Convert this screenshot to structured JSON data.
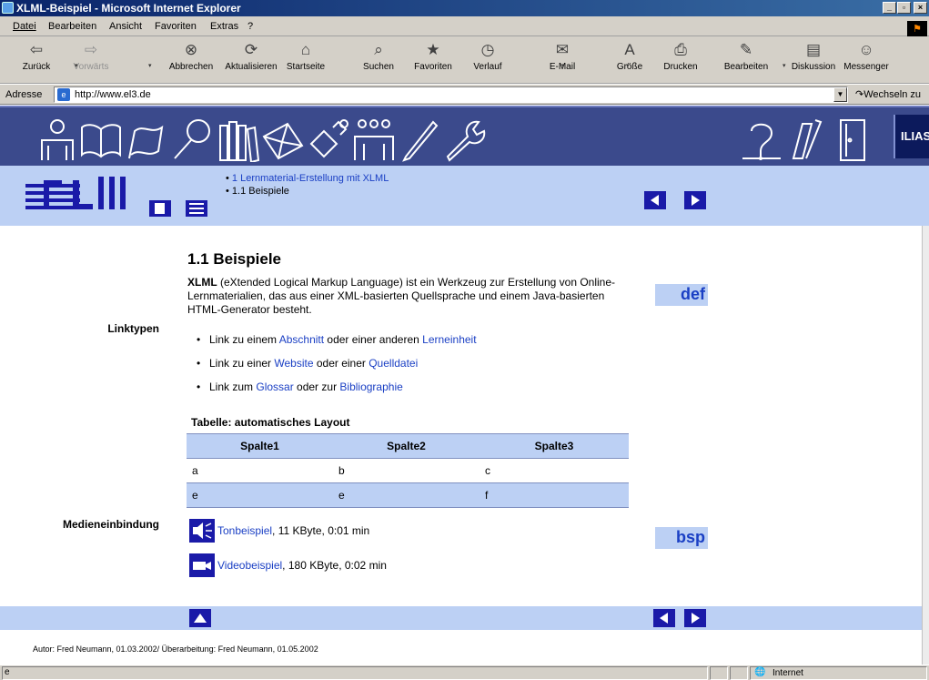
{
  "window": {
    "title": "XLML-Beispiel - Microsoft Internet Explorer",
    "min": "_",
    "max": "\b",
    "close": "x"
  },
  "menu": [
    "Datei",
    "Bearbeiten",
    "Ansicht",
    "Favoriten",
    "Extras",
    "?"
  ],
  "toolbar": [
    {
      "label": "Zurück",
      "icon": "back-icon",
      "glyph": "⇦"
    },
    {
      "label": "Vorwärts",
      "icon": "forward-icon",
      "glyph": "⇨"
    },
    {
      "label": "Abbrechen",
      "icon": "stop-icon",
      "glyph": "⊗"
    },
    {
      "label": "Aktualisieren",
      "icon": "refresh-icon",
      "glyph": "⟳"
    },
    {
      "label": "Startseite",
      "icon": "home-icon",
      "glyph": "⌂"
    },
    {
      "label": "Suchen",
      "icon": "search-icon",
      "glyph": "⌕"
    },
    {
      "label": "Favoriten",
      "icon": "favorites-icon",
      "glyph": "★"
    },
    {
      "label": "Verlauf",
      "icon": "history-icon",
      "glyph": "◷"
    },
    {
      "label": "E-Mail",
      "icon": "mail-icon",
      "glyph": "✉"
    },
    {
      "label": "Größe",
      "icon": "font-size-icon",
      "glyph": "A"
    },
    {
      "label": "Drucken",
      "icon": "print-icon",
      "glyph": "⎙"
    },
    {
      "label": "Bearbeiten",
      "icon": "edit-icon",
      "glyph": "✎"
    },
    {
      "label": "Diskussion",
      "icon": "discussion-icon",
      "glyph": "▤"
    },
    {
      "label": "Messenger",
      "icon": "messenger-icon",
      "glyph": "☺"
    }
  ],
  "address": {
    "label": "Adresse",
    "url": "http://www.el3.de",
    "go": "Wechseln zu"
  },
  "ilias": {
    "label": "ILIAS"
  },
  "breadcrumb": [
    "1 Lernmaterial-Erstellung mit XLML",
    "1.1 Beispiele"
  ],
  "page": {
    "title": "1.1 Beispiele",
    "intro_bold": "XLML",
    "intro_rest": " (eXtended Logical Markup Language) ist ein Werkzeug zur Erstellung von Online-Lernmaterialien, das aus einer XML-basierten Quellsprache und einem Java-basierten HTML-Generator besteht.",
    "def_badge": "def",
    "bsp_badge": "bsp",
    "linktypen": "Linktypen",
    "medien": "Medieneinbindung"
  },
  "links": [
    {
      "pre": "Link zu einem ",
      "a": "Abschnitt",
      "mid": " oder einer anderen ",
      "b": "Lerneinheit"
    },
    {
      "pre": "Link zu einer ",
      "a": "Website",
      "mid": " oder einer ",
      "b": "Quelldatei"
    },
    {
      "pre": "Link zum ",
      "a": "Glossar",
      "mid": " oder zur ",
      "b": "Bibliographie"
    }
  ],
  "table": {
    "caption": "Tabelle: automatisches Layout",
    "headers": [
      "Spalte1",
      "Spalte2",
      "Spalte3"
    ],
    "rows": [
      [
        "a",
        "b",
        "c"
      ],
      [
        "e",
        "e",
        "f"
      ]
    ]
  },
  "media": [
    {
      "link": "Tonbeispiel",
      "info": ", 11 KByte, 0:01 min",
      "icon": "speaker-icon"
    },
    {
      "link": "Videobeispiel",
      "info": ", 180 KByte, 0:02 min",
      "icon": "video-camera-icon"
    }
  ],
  "author": "Autor: Fred Neumann, 01.03.2002/ Überarbeitung: Fred Neumann, 01.05.2002",
  "status": {
    "zone": "Internet"
  }
}
